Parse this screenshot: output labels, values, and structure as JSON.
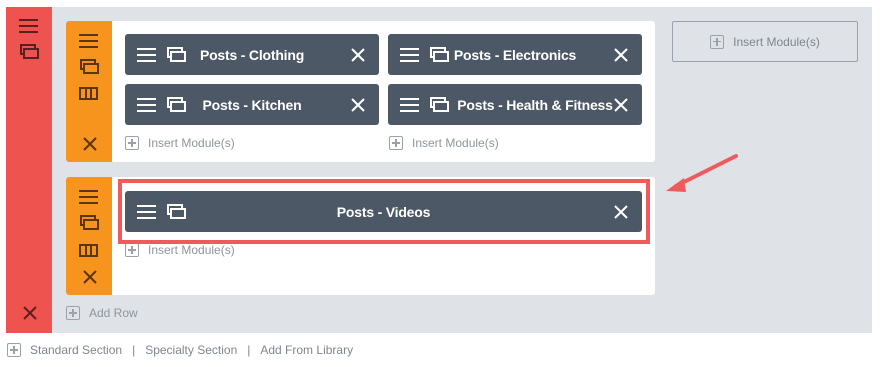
{
  "section": {
    "menu_icon": "hamburger-icon",
    "duplicate_icon": "duplicate-icon",
    "delete_icon": "close-icon",
    "add_row_label": "Add Row",
    "insert_module_label": "Insert Module(s)"
  },
  "rows": [
    {
      "icons": [
        "hamburger-icon",
        "duplicate-icon",
        "columns-icon",
        "close-icon"
      ],
      "columns": [
        {
          "modules": [
            "Posts - Clothing",
            "Posts - Kitchen"
          ],
          "insert_label": "Insert Module(s)"
        },
        {
          "modules": [
            "Posts - Electronics",
            "Posts - Health & Fitness"
          ],
          "insert_label": "Insert Module(s)"
        }
      ]
    },
    {
      "icons": [
        "hamburger-icon",
        "duplicate-icon",
        "columns-icon",
        "close-icon"
      ],
      "columns": [
        {
          "modules": [
            "Posts - Videos"
          ],
          "insert_label": "Insert Module(s)"
        }
      ]
    }
  ],
  "footer": {
    "standard_section": "Standard Section",
    "specialty_section": "Specialty Section",
    "add_from_library": "Add From Library",
    "separator": "|"
  },
  "colors": {
    "section_bar": "#ef5350",
    "row_bar": "#f7941d",
    "module_bg": "#4d5866",
    "highlight": "#ef5a5a",
    "canvas": "#dfe3e8"
  }
}
